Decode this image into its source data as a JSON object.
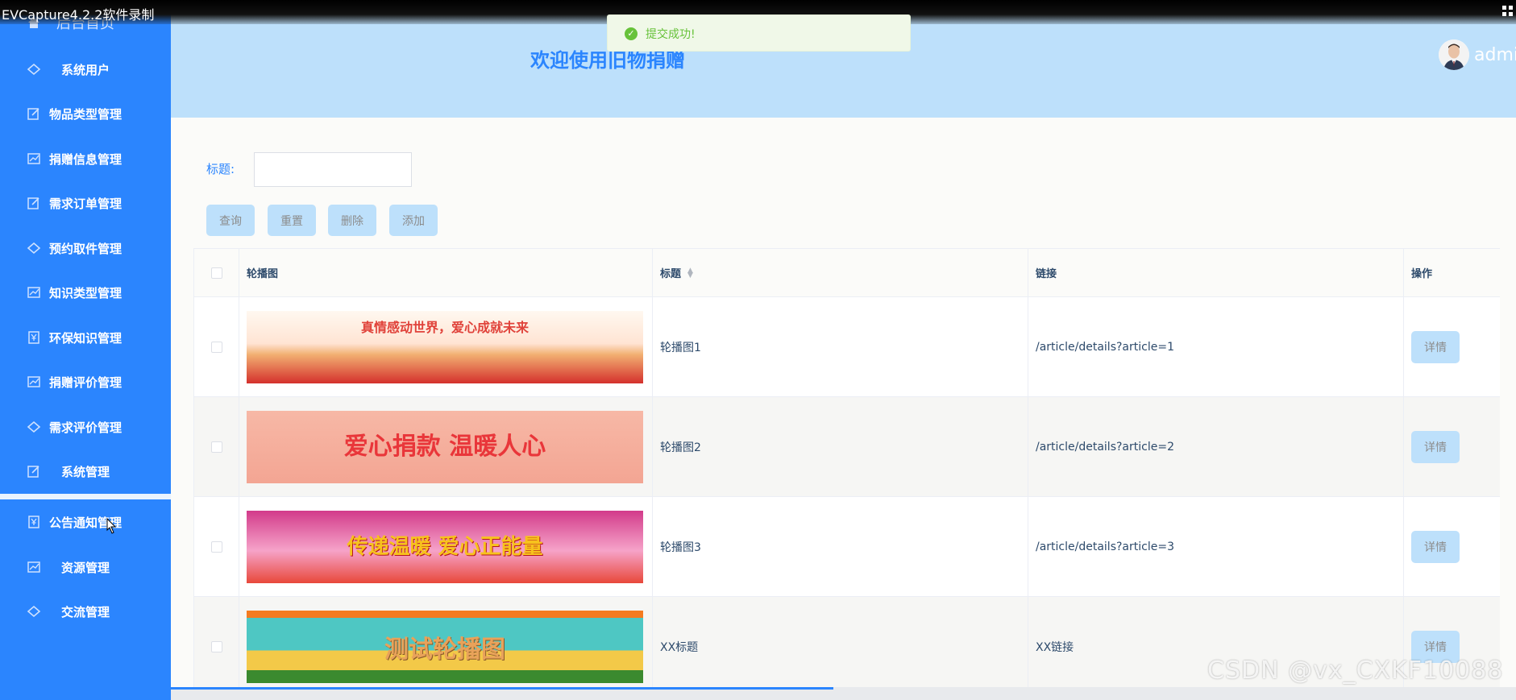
{
  "recorder": {
    "label": "EVCapture4.2.2软件录制"
  },
  "sidebar": {
    "home_label": "后台首页",
    "items": [
      {
        "label": "系统用户",
        "icon": "diamond-icon"
      },
      {
        "label": "物品类型管理",
        "icon": "edit-icon"
      },
      {
        "label": "捐赠信息管理",
        "icon": "chart-icon"
      },
      {
        "label": "需求订单管理",
        "icon": "edit-icon"
      },
      {
        "label": "预约取件管理",
        "icon": "diamond-icon"
      },
      {
        "label": "知识类型管理",
        "icon": "chart-icon"
      },
      {
        "label": "环保知识管理",
        "icon": "yen-icon"
      },
      {
        "label": "捐赠评价管理",
        "icon": "chart-icon"
      },
      {
        "label": "需求评价管理",
        "icon": "diamond-icon"
      },
      {
        "label": "系统管理",
        "icon": "edit-icon"
      },
      {
        "label": "公告通知管理",
        "icon": "yen-icon"
      },
      {
        "label": "资源管理",
        "icon": "chart-icon"
      },
      {
        "label": "交流管理",
        "icon": "diamond-icon"
      }
    ]
  },
  "header": {
    "welcome": "欢迎使用旧物捐赠",
    "username": "admin"
  },
  "toast": {
    "message": "提交成功!"
  },
  "search": {
    "label": "标题:",
    "value": ""
  },
  "buttons": {
    "query": "查询",
    "reset": "重置",
    "delete": "删除",
    "add": "添加"
  },
  "table": {
    "headers": {
      "image": "轮播图",
      "title": "标题",
      "link": "链接",
      "actions": "操作"
    },
    "rows": [
      {
        "title": "轮播图1",
        "link": "/article/details?article=1",
        "action": "详情",
        "banner_text": "真情感动世界，爱心成就未来"
      },
      {
        "title": "轮播图2",
        "link": "/article/details?article=2",
        "action": "详情",
        "banner_text": "爱心捐款 温暖人心"
      },
      {
        "title": "轮播图3",
        "link": "/article/details?article=3",
        "action": "详情",
        "banner_text": "传递温暖 爱心正能量"
      },
      {
        "title": "XX标题",
        "link": "XX链接",
        "action": "详情",
        "banner_text": "测试轮播图"
      }
    ]
  },
  "watermark": "CSDN @vx_CXKF10088",
  "colors": {
    "accent": "#2b85fe",
    "header_bg": "#bde0fb",
    "success": "#67c23a"
  }
}
